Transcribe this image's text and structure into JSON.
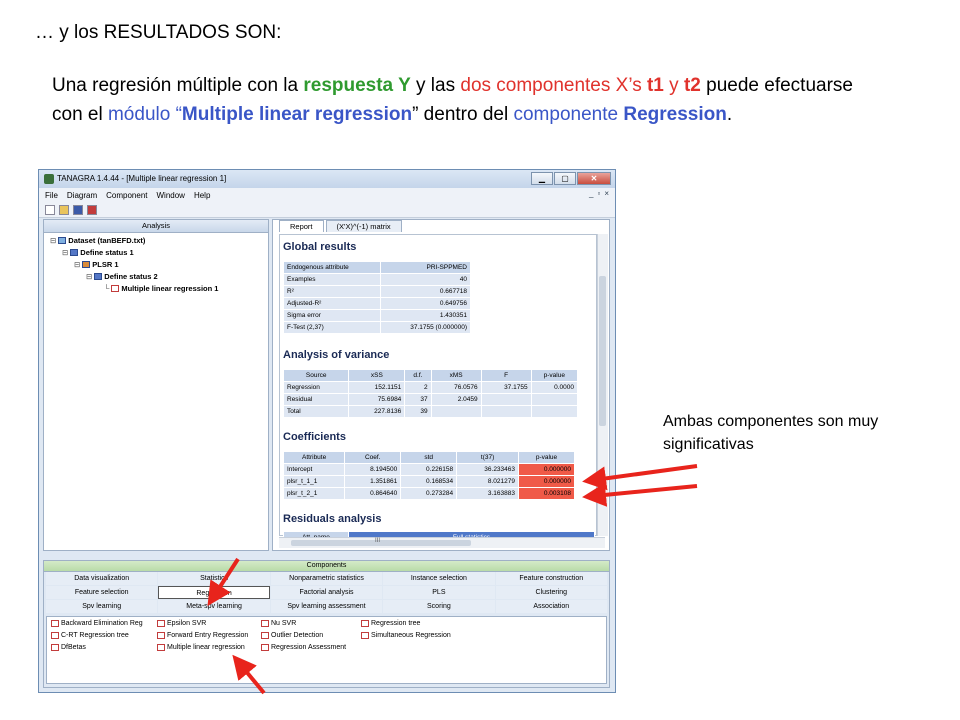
{
  "slide": {
    "title": "… y los RESULTADOS SON:",
    "intro": {
      "p1": "Una regresión múltiple con la ",
      "p2": "respuesta Y",
      "p3": " y las ",
      "p4": "dos componentes X’s ",
      "p5": "t1",
      "p6": " y ",
      "p7": "t2",
      "p8": " puede efectuarse con el ",
      "p9": "módulo “",
      "p10": "Multiple linear regression",
      "p11": "” dentro del ",
      "p12": "componente ",
      "p13": "Regression",
      "p14": "."
    },
    "callout": "Ambas componentes son muy significativas"
  },
  "window": {
    "title": "TANAGRA 1.4.44 - [Multiple linear regression 1]",
    "menu": [
      "File",
      "Diagram",
      "Component",
      "Window",
      "Help"
    ],
    "btn_min": "▁",
    "btn_max": "▢",
    "btn_close": "✕",
    "mdi_min": "_",
    "mdi_max": "▫",
    "mdi_close": "×"
  },
  "analysis": {
    "header": "Analysis",
    "tree": [
      "Dataset (tanBEFD.txt)",
      "Define status 1",
      "PLSR 1",
      "Define status 2",
      "Multiple linear regression 1"
    ]
  },
  "report": {
    "tabs": [
      "Report",
      "(X'X)^(-1) matrix"
    ],
    "global_title": "Global results",
    "global_rows": [
      [
        "Endogenous attribute",
        "PRI-SPPMED"
      ],
      [
        "Examples",
        "40"
      ],
      [
        "R²",
        "0.667718"
      ],
      [
        "Adjusted-R²",
        "0.649756"
      ],
      [
        "Sigma error",
        "1.430351"
      ],
      [
        "F-Test (2,37)",
        "37.1755 (0.000000)"
      ]
    ],
    "anova_title": "Analysis of variance",
    "anova_headers": [
      "Source",
      "xSS",
      "d.f.",
      "xMS",
      "F",
      "p-value"
    ],
    "anova_rows": [
      [
        "Regression",
        "152.1151",
        "2",
        "76.0576",
        "37.1755",
        "0.0000"
      ],
      [
        "Residual",
        "75.6984",
        "37",
        "2.0459",
        "",
        ""
      ],
      [
        "Total",
        "227.8136",
        "39",
        "",
        "",
        ""
      ]
    ],
    "coef_title": "Coefficients",
    "coef_headers": [
      "Attribute",
      "Coef.",
      "std",
      "t(37)",
      "p-value"
    ],
    "coef_rows": [
      [
        "Intercept",
        "8.194500",
        "0.226158",
        "36.233463",
        "0.000000"
      ],
      [
        "plsr_t_1_1",
        "1.351861",
        "0.168534",
        "8.021279",
        "0.000000"
      ],
      [
        "plsr_t_2_1",
        "0.864640",
        "0.273284",
        "3.163883",
        "0.003108"
      ]
    ],
    "resid_title": "Residuals analysis",
    "resid_headers": [
      "Att. name",
      "Full statistics"
    ],
    "hscroll_mark": "III"
  },
  "components": {
    "header": "Components",
    "categories": [
      [
        "Data visualization",
        "Statistics",
        "Nonparametric statistics",
        "Instance selection",
        "Feature construction"
      ],
      [
        "Feature selection",
        "Regression",
        "Factorial analysis",
        "PLS",
        "Clustering"
      ],
      [
        "Spv learning",
        "Meta-spv learning",
        "Spv learning assessment",
        "Scoring",
        "Association"
      ]
    ],
    "algorithms": [
      [
        "Backward Elimination Reg",
        "Epsilon SVR",
        "Nu SVR",
        "Regression tree"
      ],
      [
        "C-RT Regression tree",
        "Forward Entry Regression",
        "Outlier Detection",
        "Simultaneous Regression"
      ],
      [
        "DfBetas",
        "Multiple linear regression",
        "Regression Assessment",
        ""
      ]
    ]
  },
  "colors": {
    "green": "#2f9a2f",
    "red": "#e0322c",
    "blue": "#3a56c7",
    "arrow": "#e8241c"
  }
}
